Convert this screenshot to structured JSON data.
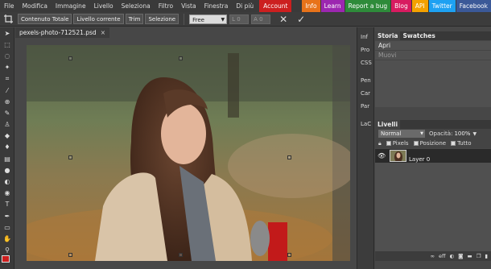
{
  "menu": {
    "items": [
      "File",
      "Modifica",
      "Immagine",
      "Livello",
      "Seleziona",
      "Filtro",
      "Vista",
      "Finestra",
      "Di più"
    ],
    "account": "Account"
  },
  "top_links": [
    {
      "label": "Info",
      "color": "#e8731a"
    },
    {
      "label": "Learn",
      "color": "#9c27b0"
    },
    {
      "label": "Report a bug",
      "color": "#2e8b3a"
    },
    {
      "label": "Blog",
      "color": "#d81b60"
    },
    {
      "label": "API",
      "color": "#f4a100"
    },
    {
      "label": "Twitter",
      "color": "#1da1f2"
    },
    {
      "label": "Facebook",
      "color": "#3b5998"
    }
  ],
  "options": {
    "buttons": [
      "Contenuto Totale",
      "Livello corrente",
      "Trim",
      "Selezione"
    ],
    "mode": "Free",
    "width_placeholder": "L  0",
    "height_placeholder": "A  0"
  },
  "document": {
    "tab_title": "pexels-photo-712521.psd",
    "close_glyph": "×"
  },
  "panels_collapsed": [
    "Inf",
    "Pro",
    "CSS",
    "Pen",
    "Car",
    "Par",
    "LaC"
  ],
  "history_panel": {
    "tabs": [
      "Storia",
      "Swatches"
    ],
    "items": [
      "Apri",
      "Muovi"
    ]
  },
  "layers_panel": {
    "tab": "Livelli",
    "blend_mode": "Normal",
    "opacity_label": "Opacità:",
    "opacity_value": "100%",
    "lock_options": [
      "Pixels",
      "Posizione",
      "Tutto"
    ],
    "layers": [
      {
        "name": "Layer 0"
      }
    ],
    "footer": [
      "eff"
    ]
  },
  "colors": {
    "foreground": "#cc1e1e",
    "background": "#111111",
    "accent": "#cc1f1f"
  }
}
